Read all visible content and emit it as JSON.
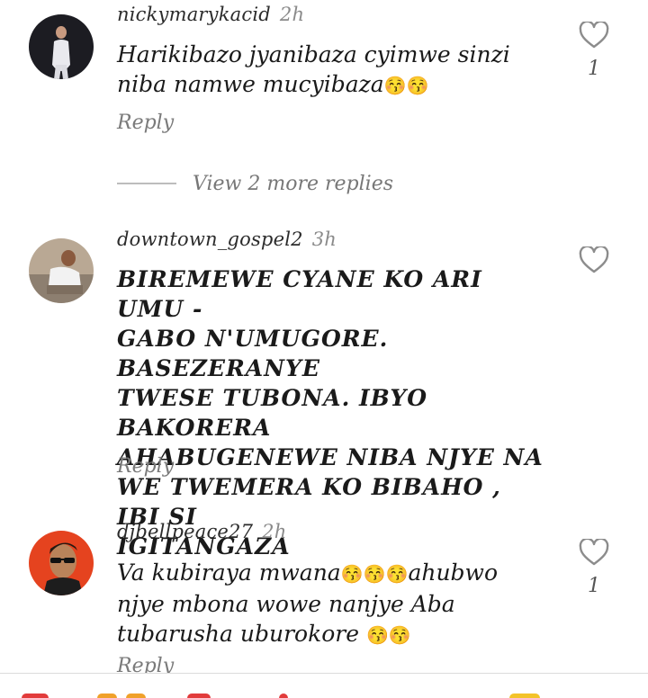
{
  "comments": [
    {
      "username": "nickymarykacid",
      "time": "2h",
      "text": "Harikibazo jyanibaza cyimwe sinzi niba namwe mucyibaza",
      "emojis": "😚😚",
      "reply_label": "Reply",
      "likes": "1"
    },
    {
      "username": "downtown_gospel2",
      "time": "3h",
      "text": "BIREMEWE CYANE KO ARI UMU -\nGABO N'UMUGORE. BASEZERANYE\nTWESE TUBONA. IBYO BAKORERA\nAHABUGENEWE NIBA NJYE NA\nWE TWEMERA KO BIBAHO , IBI SI\nIGITANGAZA",
      "reply_label": "Reply",
      "likes": ""
    },
    {
      "username": "djbellpeace27",
      "time": "2h",
      "text_part1": "Va kubiraya mwana",
      "emojis1": "😚😚😚",
      "text_part2": "ahubwo njye mbona wowe nanjye Aba tubarusha uburokore ",
      "emojis2": "😚😚",
      "reply_label": "Reply",
      "likes": "1"
    }
  ],
  "view_more_replies": "View 2 more replies",
  "colors": {
    "username": "#2b2b2b",
    "timestamp": "#8a8a8a",
    "reply": "#7a7a7a",
    "heart": "#8c8c8c",
    "emoji": "#e05ab7"
  }
}
